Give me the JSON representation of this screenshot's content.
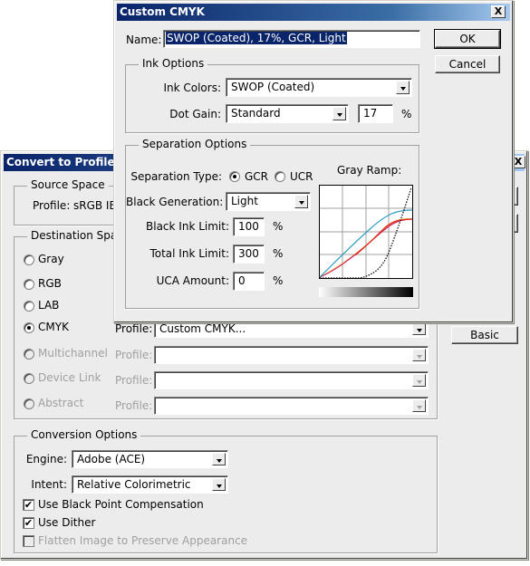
{
  "convert": {
    "title": "Convert to Profile Adv",
    "source": {
      "legend": "Source Space",
      "profile_label": "Profile:",
      "profile_value": "sRGB IEC"
    },
    "destination": {
      "legend": "Destination Spac",
      "options": [
        {
          "label": "Gray",
          "selected": false,
          "enabled": true
        },
        {
          "label": "RGB",
          "selected": false,
          "enabled": true
        },
        {
          "label": "LAB",
          "selected": false,
          "enabled": true
        },
        {
          "label": "CMYK",
          "selected": true,
          "enabled": true,
          "profile": "Custom CMYK..."
        },
        {
          "label": "Multichannel",
          "selected": false,
          "enabled": false,
          "profile": ""
        },
        {
          "label": "Device Link",
          "selected": false,
          "enabled": false,
          "profile": ""
        },
        {
          "label": "Abstract",
          "selected": false,
          "enabled": false,
          "profile": ""
        }
      ],
      "profile_label": "Profile:"
    },
    "conversion": {
      "legend": "Conversion Options",
      "engine_label": "Engine:",
      "engine": "Adobe (ACE)",
      "intent_label": "Intent:",
      "intent": "Relative Colorimetric",
      "checks": [
        {
          "label": "Use Black Point Compensation",
          "checked": true,
          "enabled": true
        },
        {
          "label": "Use Dither",
          "checked": true,
          "enabled": true
        },
        {
          "label": "Flatten Image to Preserve Appearance",
          "checked": false,
          "enabled": false
        }
      ]
    },
    "basic_label": "Basic",
    "close_label": "X"
  },
  "cmyk": {
    "title": "Custom CMYK",
    "close_label": "X",
    "name_label": "Name:",
    "name_value": "SWOP (Coated), 17%, GCR, Light",
    "ok_label": "OK",
    "cancel_label": "Cancel",
    "ink": {
      "legend": "Ink Options",
      "ink_colors_label": "Ink Colors:",
      "ink_colors": "SWOP (Coated)",
      "dot_gain_label": "Dot Gain:",
      "dot_gain": "Standard",
      "dot_gain_value": "17",
      "pct": "%"
    },
    "separation": {
      "legend": "Separation Options",
      "type_label": "Separation Type:",
      "gcr": "GCR",
      "ucr": "UCR",
      "selected_type": "GCR",
      "black_gen_label": "Black Generation:",
      "black_gen": "Light",
      "black_limit_label": "Black Ink Limit:",
      "black_limit": "100",
      "total_limit_label": "Total Ink Limit:",
      "total_limit": "300",
      "uca_label": "UCA Amount:",
      "uca": "0",
      "pct": "%",
      "gray_ramp_label": "Gray Ramp:",
      "ramp_colors": {
        "cyan": "#2a9bc4",
        "magenta": "#d0206a",
        "yellow": "#f4d04a",
        "red": "#e03010",
        "black": "#000000"
      }
    }
  }
}
